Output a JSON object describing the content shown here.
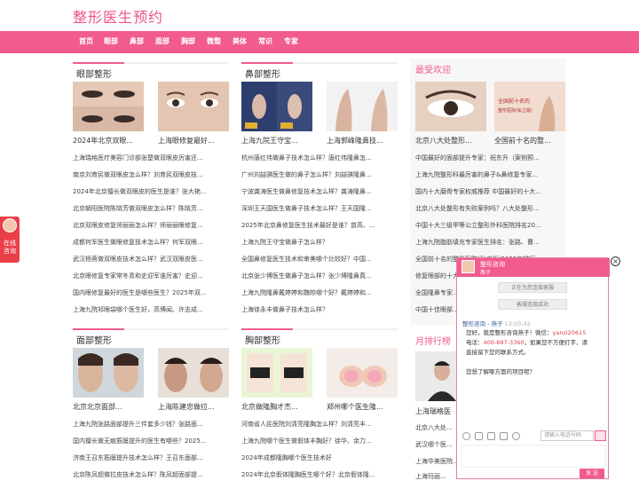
{
  "site": {
    "title": "整形医生预约"
  },
  "nav": {
    "items": [
      "首页",
      "眼部",
      "鼻部",
      "面部",
      "胸部",
      "微整",
      "美体",
      "常识",
      "专家"
    ]
  },
  "sections": {
    "eye": {
      "title": "眼部整形",
      "captions": [
        "2024年北京双眼...",
        "上海眼修复最好..."
      ],
      "list": [
        "上海瑞格医疗美容门诊部张楚做双眼皮厉害还...",
        "南京刘育民做双眼皮怎么样？刘育民双眼皮技...",
        "2024年北京擅长做双眼皮的医生是谁？张大艳...",
        "北京朝阳医院陈晓芳做双眼皮怎么样？陈晓芳...",
        "北京双眼皮修复师丽丽怎么样？师丽丽眼修复...",
        "成都何军医生做眼修复技术怎么样？何军双眼...",
        "武汉杨蓉做双眼皮技术怎么样？武汉双眼皮医...",
        "北京眼修复专家常冬青和史迎军谁厉害？史迎...",
        "国内眼修复最好的医生是哪些医生？2025年双...",
        "上海九院祁眼袋哪个医生好，高博闻、许志成..."
      ]
    },
    "nose": {
      "title": "鼻部整形",
      "captions": [
        "上海九院王守宝...",
        "上海郭峰隆鼻技..."
      ],
      "list": [
        "杭州唐红伟做鼻子技术怎么样？唐红伟隆鼻怎...",
        "广州刘喆骐医生做的鼻子怎么样？刘喆骐隆鼻...",
        "宁波龚涛医生做鼻修复技术怎么样？龚涛隆鼻...",
        "深圳王天国医生做鼻子技术怎么样？王天国隆...",
        "2025年北京鼻修复医生技术最好是谁？曾高、...",
        "上海九院王守宝做鼻子怎么样？",
        "全国鼻修复医生技术和审美哪个比较好？中国...",
        "北京张少博医生做鼻子怎么样？张少博隆鼻真...",
        "上海九院隆鼻戴婷婷和魏皎哪个好？戴婷婷和...",
        "上海徐永丰做鼻子技术怎么样？"
      ]
    },
    "face": {
      "title": "面部整形",
      "captions": [
        "北京北京面部...",
        "上海陈建忠做拉..."
      ],
      "list": [
        "上海九院张路面部提升三件套多少钱？张路面...",
        "国内擅长做无痕筋膜提升的医生有哪些？2025...",
        "济南王召东筋膜提升技术怎么样？王召东面部...",
        "北京陈凤超做拉皮技术怎么样？陈凤超面部提..."
      ]
    },
    "chest": {
      "title": "胸部整形",
      "captions": [
        "北京做隆胸才杰...",
        "郑州哪个医生隆..."
      ],
      "list": [
        "河南省人民医院刘清亮隆胸怎么样？刘清亮丰...",
        "上海九院哪个医生做假体丰胸好？徐华、余力...",
        "2024年成都隆胸哪个医生技术好",
        "2024年北京假体隆胸医生哪个好？北京假体隆..."
      ]
    },
    "popular": {
      "title": "最受欢迎",
      "captions": [
        "北京八大处整形...",
        "全国前十名的整..."
      ],
      "thumb2_text": "全国前十名的 整形医院(私立版)",
      "list": [
        "中国最好的面部提升专家：祝东升（案例预...",
        "上海九院整形科最厉害的鼻子&鼻修复专家...",
        "国内十大磨骨专家权威推荐 中国最好的十大...",
        "北京八大处整形有失败案例吗？八大处整形...",
        "中国十大三级甲等公立整形外科医院排名20...",
        "上海九院脂肪填充专家医生排名：张路、曹...",
        "全国前十名的整形医院(私立版)2025年排行...",
        "修复眼部的十大专家...",
        "全国隆鼻专家...",
        "中国十佳眼部..."
      ]
    },
    "ranking": {
      "title": "月排行榜",
      "caption": "上海瑞格医",
      "list": [
        "北京八大处...",
        "武汉哪个医...",
        "上海华美医院...",
        "上海玛丽..."
      ]
    }
  },
  "float_left": {
    "label": "在线咨询"
  },
  "chat": {
    "header_title": "整形咨询",
    "header_sub": "燕子",
    "sys_msgs": [
      "正在为您连接客服",
      "客服连接成功"
    ],
    "sender": "整形咨询 - 燕子",
    "time": "13:03:42",
    "msg_line1": "您好，我是整形咨询燕子！微信：",
    "wechat": "yanzi20615",
    "msg_line2_prefix": "电话：",
    "phone": "400-897-3360",
    "msg_line2_suffix": "，如果您不方便打字，请",
    "msg_line3": "直接留下您的联系方式。",
    "msg_line4": "您想了解哪方面的项目呢？",
    "input_placeholder": "请输入电话号码",
    "send_label": "发 送",
    "close_label": "×"
  },
  "colors": {
    "accent": "#f15b8f",
    "title": "#f0508a",
    "float": "#ea3f49"
  }
}
